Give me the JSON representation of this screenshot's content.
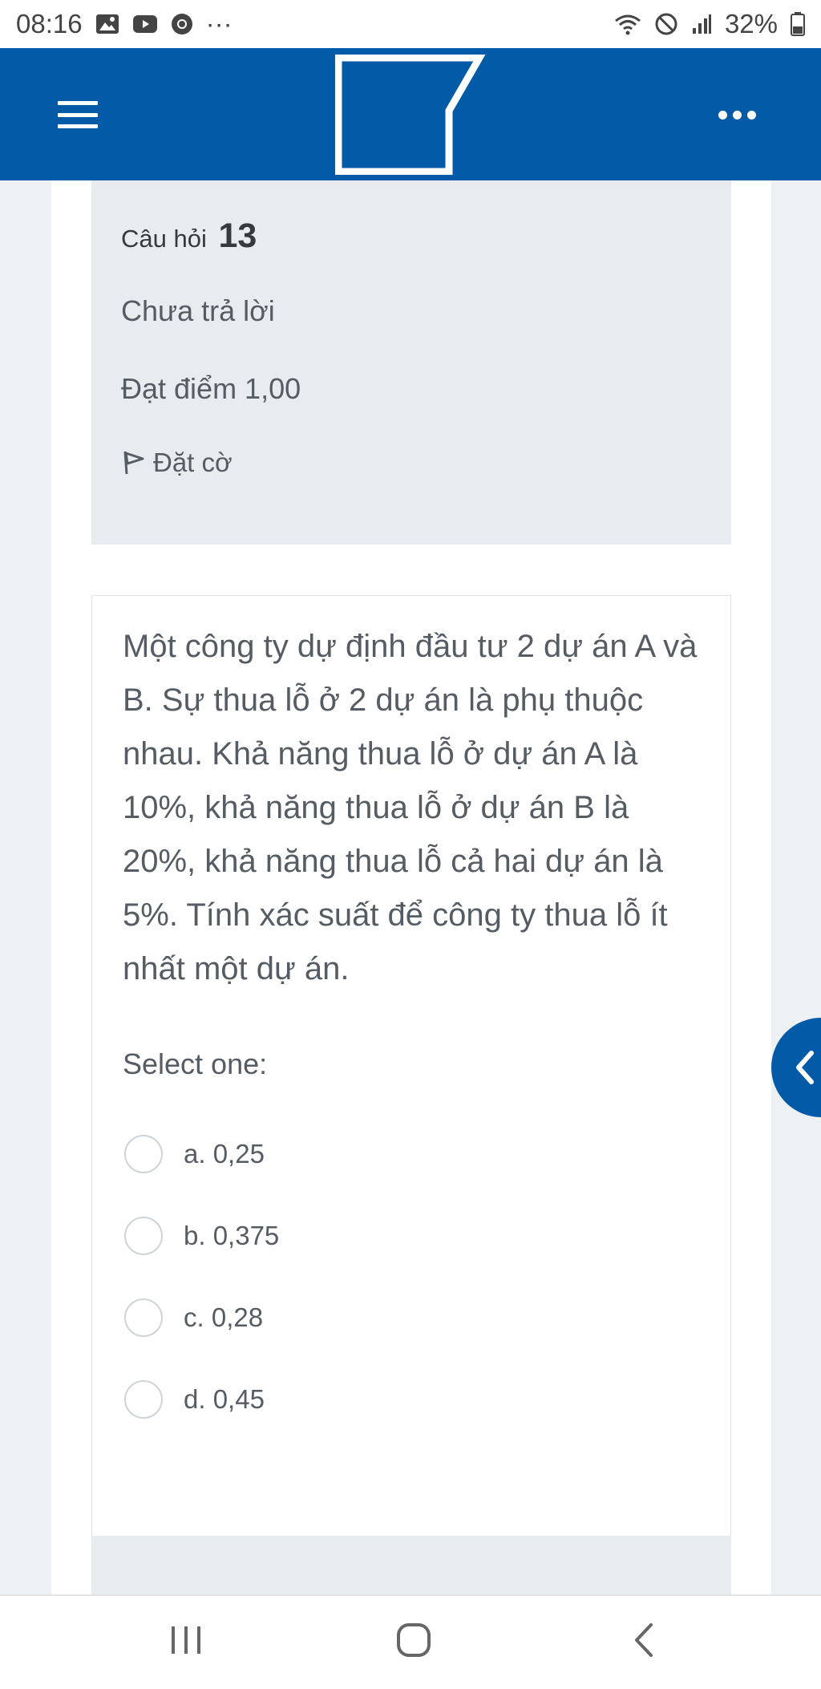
{
  "status_bar": {
    "time": "08:16",
    "overflow": "···",
    "battery": "32%",
    "icons": [
      "gallery-icon",
      "youtube-icon",
      "chrome-icon",
      "wifi-icon",
      "do-not-disturb-icon",
      "signal-icon",
      "battery-icon"
    ]
  },
  "app_bar": {
    "icons": [
      "hamburger-icon",
      "site-logo",
      "more-icon"
    ]
  },
  "question_info": {
    "label": "Câu hỏi",
    "number": "13",
    "state": "Chưa trả lời",
    "grade": "Đạt điểm 1,00",
    "flag_label": "Đặt cờ"
  },
  "question": {
    "text": "Một công ty dự định đầu tư 2 dự án A và B. Sự thua lỗ ở 2 dự án là phụ thuộc nhau. Khả năng thua lỗ ở dự án A là 10%, khả năng thua lỗ ở dự án B là 20%, khả năng thua lỗ cả hai dự án là 5%. Tính xác suất để công ty thua lỗ ít nhất một dự án.",
    "prompt": "Select one:",
    "answers": [
      {
        "label": "a. 0,25",
        "selected": false
      },
      {
        "label": "b. 0,375",
        "selected": false
      },
      {
        "label": "c. 0,28",
        "selected": false
      },
      {
        "label": "d. 0,45",
        "selected": false
      }
    ]
  },
  "colors": {
    "brand": "#035aa6",
    "info_bg": "#e9ecef",
    "page_bg": "#eef1f4",
    "text_muted": "#555c63"
  }
}
